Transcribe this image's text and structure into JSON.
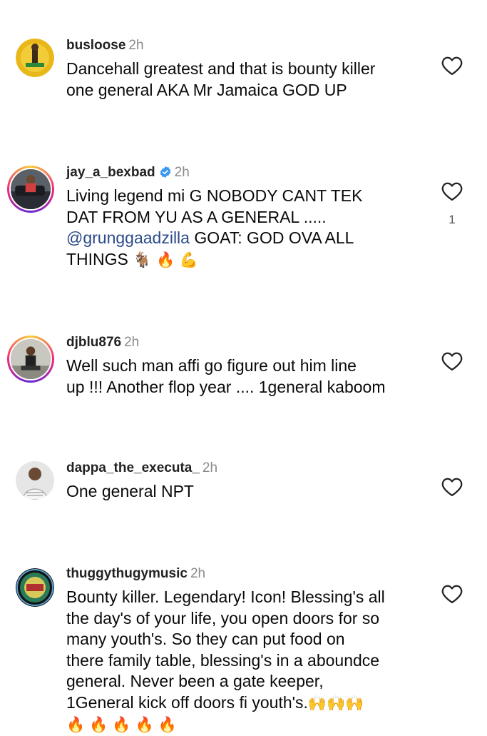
{
  "comments": [
    {
      "username": "busloose",
      "time": "2h",
      "lines": [
        "Dancehall greatest and that is bounty killer",
        "one general AKA Mr Jamaica GOD UP"
      ],
      "likes": ""
    },
    {
      "username": "jay_a_bexbad",
      "time": "2h",
      "verified": true,
      "line1": "Living legend mi G NOBODY CANT TEK",
      "line2": "DAT FROM YU AS A GENERAL .....",
      "mention": "@grunggaadzilla",
      "line3_rest": " GOAT: GOD OVA ALL",
      "line4": "THINGS",
      "line4_emoji": "🐐 🔥 💪",
      "likes": "1"
    },
    {
      "username": "djblu876",
      "time": "2h",
      "lines": [
        "Well such man affi go figure out him line",
        "up !!! Another flop year .... 1general kaboom"
      ],
      "likes": ""
    },
    {
      "username": "dappa_the_executa_",
      "time": "2h",
      "lines": [
        "One general NPT"
      ],
      "likes": ""
    },
    {
      "username": "thuggythugymusic",
      "time": "2h",
      "lines": [
        "Bounty killer. Legendary! Icon! Blessing's all",
        "the day's of your life, you open doors for so",
        "many youth's. So they can put food on",
        "there family table,  blessing's in a aboundce",
        "general. Never been a gate keeper,"
      ],
      "line6": "1General kick off doors fi youth's.",
      "line6_emoji": "🙌🙌🙌",
      "line7_emoji": "🔥🔥🔥🔥🔥",
      "likes": ""
    }
  ],
  "colors": {
    "verified": "#3897f0",
    "mention": "#2a4a8a",
    "time": "#8a8a8a"
  }
}
